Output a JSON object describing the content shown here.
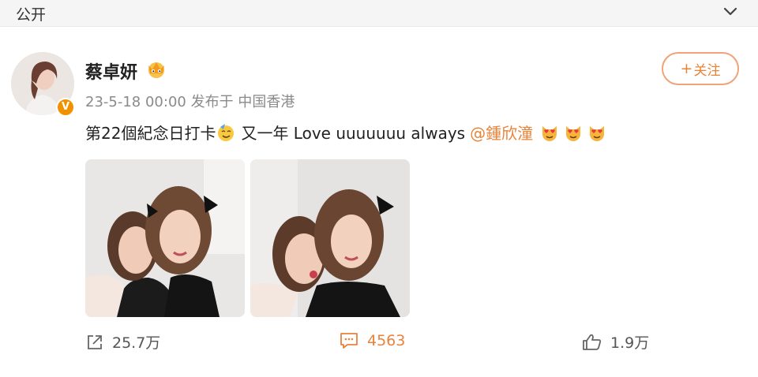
{
  "header": {
    "scope": "公开",
    "scope_dropdown_icon": "chevron-down-icon"
  },
  "post": {
    "author": "蔡卓妍",
    "verified_badge": "V",
    "time": "23-5-18 00:00",
    "published_from": "发布于 中国香港",
    "follow_label": "关注",
    "follow_plus": "+",
    "text_main": "第22個紀念日打卡",
    "text_middle": "又一年 Love uuuuuuu always",
    "mention": "@鍾欣潼"
  },
  "actions": {
    "repost_count": "25.7万",
    "comment_count": "4563",
    "like_count": "1.9万"
  },
  "colors": {
    "accent": "#e8833a",
    "badge": "#f29100",
    "meta": "#8a8a8a"
  }
}
